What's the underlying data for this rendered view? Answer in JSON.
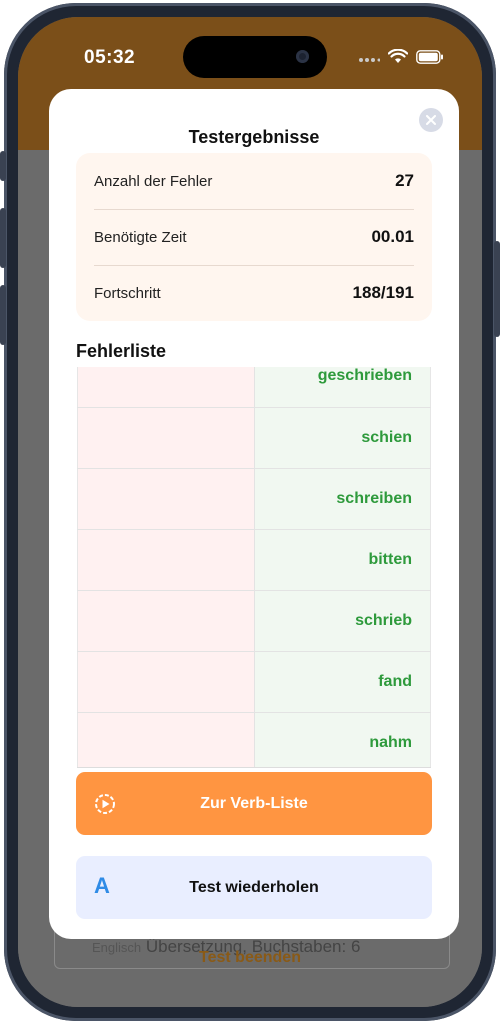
{
  "status": {
    "time": "05:32"
  },
  "modal": {
    "title": "Testergebnisse",
    "stats": [
      {
        "label": "Anzahl der Fehler",
        "value": "27"
      },
      {
        "label": "Benötigte Zeit",
        "value": "00.01"
      },
      {
        "label": "Fortschritt",
        "value": "188/191"
      }
    ],
    "mistakes_title": "Fehlerliste",
    "mistakes": [
      "geschrieben",
      "schien",
      "schreiben",
      "bitten",
      "schrieb",
      "fand",
      "nahm"
    ],
    "verb_list_button": "Zur Verb-Liste",
    "retry_button": "Test wiederholen",
    "retry_icon_letter": "A"
  },
  "background": {
    "hint_prefix": "Englisch",
    "hint_text": "Übersetzung, Buchstaben: 6",
    "end_test": "Test beenden"
  },
  "colors": {
    "header": "#7b4f19",
    "accent_orange": "#ff9541",
    "correct_green": "#2e9a3c",
    "retry_bg": "#e9eeff",
    "retry_icon": "#2f8be6"
  }
}
